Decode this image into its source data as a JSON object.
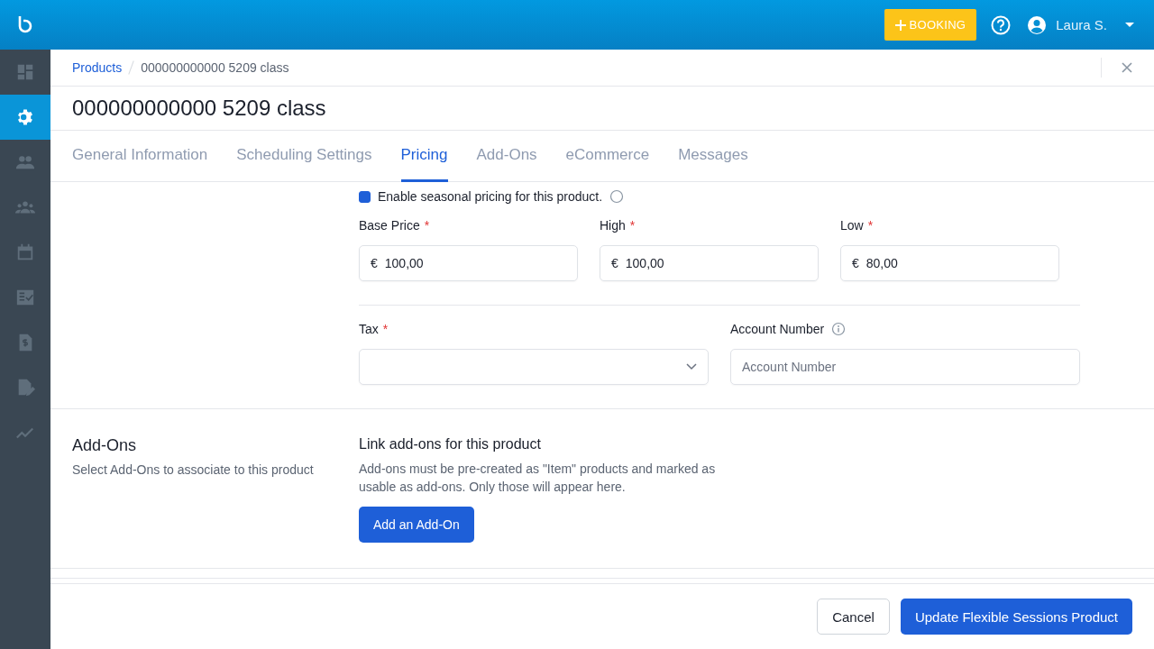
{
  "topbar": {
    "booking_button": "BOOKING",
    "user_name": "Laura S."
  },
  "sidebar": {
    "items": [
      {
        "kind": "dashboard",
        "selected": false
      },
      {
        "kind": "settings",
        "selected": true
      },
      {
        "kind": "people",
        "selected": false
      },
      {
        "kind": "groups",
        "selected": false
      },
      {
        "kind": "calendar",
        "selected": false
      },
      {
        "kind": "checklist",
        "selected": false
      },
      {
        "kind": "invoice",
        "selected": false
      },
      {
        "kind": "document-edit",
        "selected": false
      },
      {
        "kind": "chart",
        "selected": false
      }
    ]
  },
  "breadcrumb": [
    {
      "label": "Products",
      "kind": "link"
    },
    {
      "label": "000000000000 5209 class",
      "kind": "current"
    }
  ],
  "title": "000000000000 5209 class",
  "tabs": [
    {
      "label": "General Information",
      "selected": false
    },
    {
      "label": "Scheduling Settings",
      "selected": false
    },
    {
      "label": "Pricing",
      "selected": true
    },
    {
      "label": "Add-Ons",
      "selected": false
    },
    {
      "label": "eCommerce",
      "selected": false
    },
    {
      "label": "Messages",
      "selected": false
    }
  ],
  "pricing": {
    "seasonal_checkbox": {
      "label": "Enable seasonal pricing for this product.",
      "checked": true
    },
    "prices": [
      {
        "label": "Base Price",
        "required_mark": "*",
        "currency": "€",
        "value": "100,00"
      },
      {
        "label": "High",
        "required_mark": "*",
        "currency": "€",
        "value": "100,00"
      },
      {
        "label": "Low",
        "required_mark": "*",
        "currency": "€",
        "value": "80,00"
      }
    ],
    "tax": {
      "label": "Tax",
      "required_mark": "*"
    },
    "account_number": {
      "label": "Account Number",
      "placeholder": "Account Number"
    }
  },
  "addons": {
    "title": "Add-Ons",
    "description": "Select Add-Ons to associate to this product",
    "heading": "Link add-ons for this product",
    "help": "Add-ons must be pre-created as \"Item\" products and marked as usable as add-ons. Only those will appear here.",
    "button": "Add an Add-On"
  },
  "footer": {
    "buttons": [
      {
        "label": "Cancel",
        "kind": "secondary"
      },
      {
        "label": "Update Flexible Sessions Product",
        "kind": "primary"
      }
    ]
  }
}
